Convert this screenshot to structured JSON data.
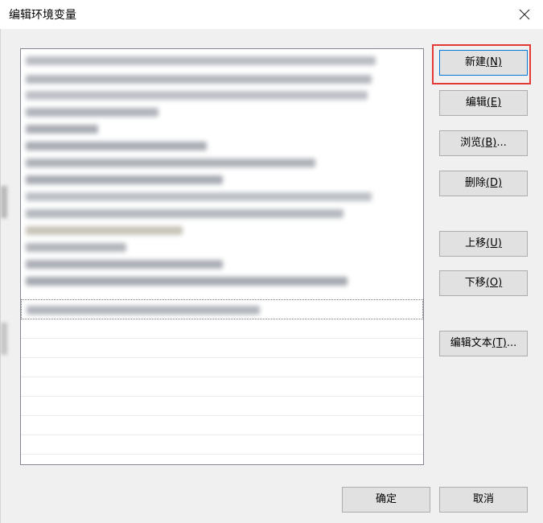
{
  "window": {
    "title": "编辑环境变量",
    "close_icon": "close-icon"
  },
  "list": {
    "items_note": "obscured",
    "entries_count_visible": 14
  },
  "buttons": {
    "new": {
      "label": "新建",
      "accel": "(N)"
    },
    "edit": {
      "label": "编辑",
      "accel": "(E)"
    },
    "browse": {
      "label": "浏览",
      "accel": "(B)",
      "suffix": "..."
    },
    "delete": {
      "label": "删除",
      "accel": "(D)"
    },
    "move_up": {
      "label": "上移",
      "accel": "(U)"
    },
    "move_down": {
      "label": "下移",
      "accel": "(O)"
    },
    "edit_text": {
      "label": "编辑文本",
      "accel": "(T)",
      "suffix": "..."
    },
    "ok": {
      "label": "确定"
    },
    "cancel": {
      "label": "取消"
    }
  },
  "colors": {
    "highlight": "#e53935",
    "default_border": "#0078d7",
    "button_bg": "#e1e1e1",
    "dialog_bg": "#f0f0f0"
  }
}
